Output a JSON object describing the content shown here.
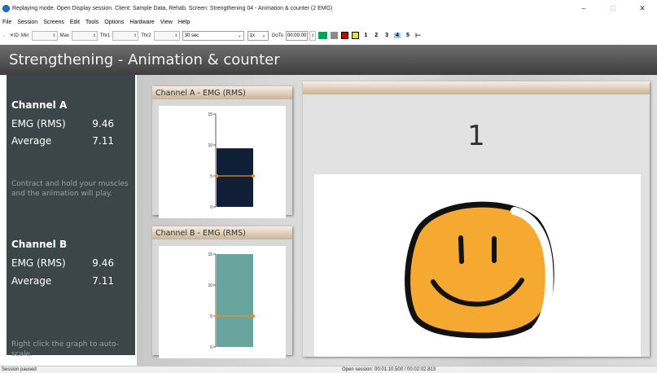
{
  "window": {
    "title": "Replaying mode. Open Display session. Client: Sample Data, Rehab. Screen: Strengthening 04 - Animation & counter (2 EMG)",
    "controls": [
      "–",
      "□",
      "✕"
    ]
  },
  "menu": [
    "File",
    "Session",
    "Screens",
    "Edit",
    "Tools",
    "Options",
    "Hardware",
    "View",
    "Help"
  ],
  "toolbar": {
    "mode_label": "✕ID",
    "min_label": "Min",
    "max_label": "Max",
    "thr1_label": "Thr1",
    "thr2_label": "Thr2",
    "timebase": "30 sec",
    "speed": "1x",
    "goto_label": "GoTo",
    "goto_value": "00:00:00",
    "screen_numbers": [
      "1",
      "2",
      "3",
      "4",
      "5"
    ],
    "active_screen": "4",
    "colors": {
      "green": "#00a651",
      "gray": "#8c8c8c",
      "red": "#cc0000",
      "yellow": "#e8e800"
    }
  },
  "header": {
    "title": "Strengthening - Animation & counter"
  },
  "side": {
    "channel_a": {
      "title": "Channel A",
      "emg_label": "EMG (RMS)",
      "emg_value": "9.46",
      "avg_label": "Average",
      "avg_value": "7.11"
    },
    "note_a": [
      "Contract and hold your muscles",
      "and the animation will play."
    ],
    "channel_b": {
      "title": "Channel B",
      "emg_label": "EMG (RMS)",
      "emg_value": "9.46",
      "avg_label": "Average",
      "avg_value": "7.11"
    },
    "note_b": "Right click the graph to auto-scale."
  },
  "chart_data": [
    {
      "type": "bar",
      "title": "Channel A - EMG (RMS)",
      "values": [
        9.46
      ],
      "threshold": 5,
      "ylim": [
        0,
        15
      ],
      "yticks": [
        "0",
        "5",
        "10",
        "15"
      ],
      "bar_color": "#101e36",
      "threshold_color": "#f0901e"
    },
    {
      "type": "bar",
      "title": "Channel B - EMG (RMS)",
      "values": [
        15
      ],
      "threshold": 5,
      "ylim": [
        0,
        15
      ],
      "yticks": [
        "0",
        "5",
        "10",
        "15"
      ],
      "bar_color": "#68a59f",
      "threshold_color": "#f0901e"
    }
  ],
  "animation": {
    "counter": "1",
    "face_color": "#f5a930"
  },
  "status": {
    "left": "Session paused",
    "right": "Open session: 00:01:10.500 / 00:02:02.813"
  }
}
